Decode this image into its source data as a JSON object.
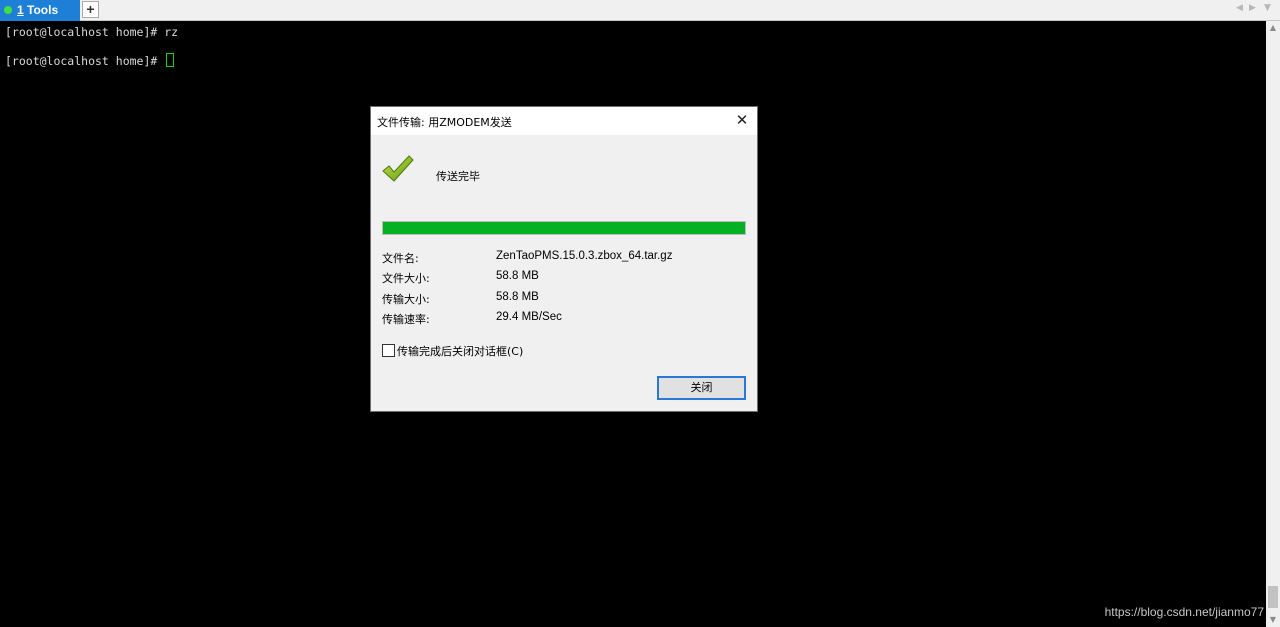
{
  "tabs": [
    {
      "number": "1",
      "label": " Tools"
    }
  ],
  "new_tab_icon": "plus-icon",
  "nav_icons": [
    "chevron-left-icon",
    "chevron-right-icon",
    "chevron-down-icon"
  ],
  "terminal": {
    "lines": [
      "[root@localhost home]# rz",
      "[root@localhost home]# "
    ],
    "cursor_color": "#19d019"
  },
  "dialog": {
    "title": "文件传输: 用ZMODEM发送",
    "status": "传送完毕",
    "progress": 1.0,
    "progress_color": "#06b025",
    "info": [
      {
        "label": "文件名:",
        "value": "ZenTaoPMS.15.0.3.zbox_64.tar.gz"
      },
      {
        "label": "文件大小:",
        "value": "58.8 MB"
      },
      {
        "label": "传输大小:",
        "value": "58.8 MB"
      },
      {
        "label": "传输速率:",
        "value": "29.4 MB/Sec"
      }
    ],
    "auto_close_checkbox": {
      "label": "传输完成后关闭对话框(C)",
      "checked": false
    },
    "close_button": "关闭"
  },
  "watermark": "https://blog.csdn.net/jianmo77"
}
